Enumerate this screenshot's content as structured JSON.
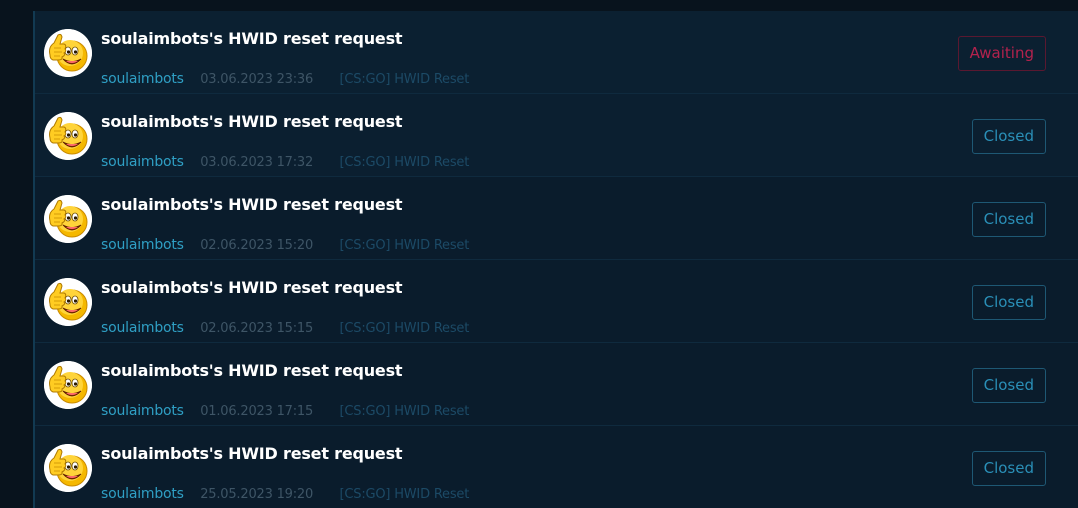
{
  "requests": [
    {
      "title": "soulaimbots's HWID reset request",
      "user": "soulaimbots",
      "date": "03.06.2023 23:36",
      "tag": "[CS:GO] HWID Reset",
      "status": "Awaiting",
      "status_type": "awaiting"
    },
    {
      "title": "soulaimbots's HWID reset request",
      "user": "soulaimbots",
      "date": "03.06.2023 17:32",
      "tag": "[CS:GO] HWID Reset",
      "status": "Closed",
      "status_type": "closed"
    },
    {
      "title": "soulaimbots's HWID reset request",
      "user": "soulaimbots",
      "date": "02.06.2023 15:20",
      "tag": "[CS:GO] HWID Reset",
      "status": "Closed",
      "status_type": "closed"
    },
    {
      "title": "soulaimbots's HWID reset request",
      "user": "soulaimbots",
      "date": "02.06.2023 15:15",
      "tag": "[CS:GO] HWID Reset",
      "status": "Closed",
      "status_type": "closed"
    },
    {
      "title": "soulaimbots's HWID reset request",
      "user": "soulaimbots",
      "date": "01.06.2023 17:15",
      "tag": "[CS:GO] HWID Reset",
      "status": "Closed",
      "status_type": "closed"
    },
    {
      "title": "soulaimbots's HWID reset request",
      "user": "soulaimbots",
      "date": "25.05.2023 19:20",
      "tag": "[CS:GO] HWID Reset",
      "status": "Closed",
      "status_type": "closed"
    }
  ],
  "avatar_icon": "thumbs-up-smiley-icon",
  "colors": {
    "background": "#0a1c2c",
    "title": "#ffffff",
    "username": "#2f9fc4",
    "closed": "#2a8fb7",
    "awaiting": "#b3224d"
  }
}
